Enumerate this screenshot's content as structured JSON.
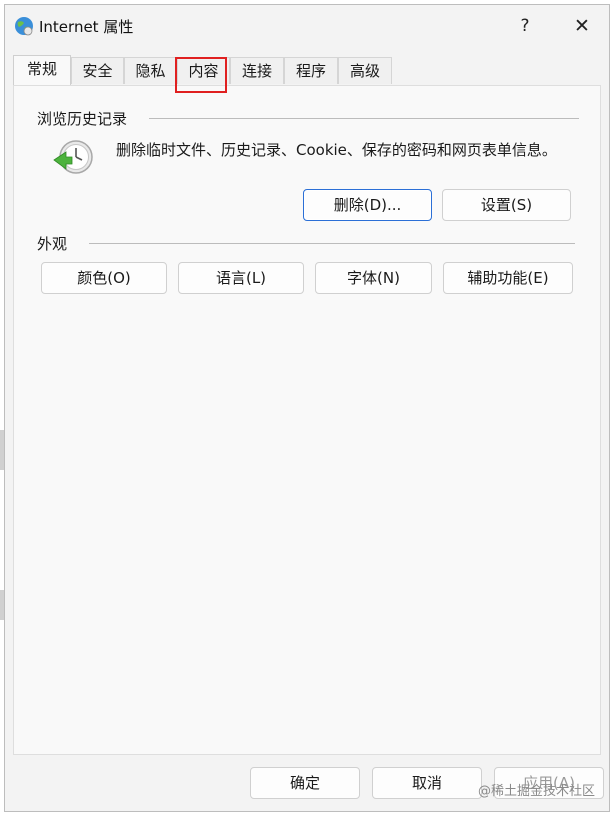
{
  "window": {
    "title": "Internet 属性",
    "help_label": "?",
    "close_label": "✕",
    "icon": "internet-options-globe-icon"
  },
  "tabs": [
    {
      "label": "常规",
      "active": true
    },
    {
      "label": "安全",
      "active": false
    },
    {
      "label": "隐私",
      "active": false
    },
    {
      "label": "内容",
      "active": false,
      "highlighted": true
    },
    {
      "label": "连接",
      "active": false
    },
    {
      "label": "程序",
      "active": false
    },
    {
      "label": "高级",
      "active": false
    }
  ],
  "browsing_history": {
    "group_label": "浏览历史记录",
    "description": "删除临时文件、历史记录、Cookie、保存的密码和网页表单信息。",
    "icon": "history-clock-icon",
    "delete_button": "删除(D)...",
    "settings_button": "设置(S)"
  },
  "appearance": {
    "group_label": "外观",
    "colors_button": "颜色(O)",
    "languages_button": "语言(L)",
    "fonts_button": "字体(N)",
    "accessibility_button": "辅助功能(E)"
  },
  "footer": {
    "ok_button": "确定",
    "cancel_button": "取消",
    "apply_button": "应用(A)"
  },
  "watermark": "@稀土掘金技术社区",
  "colors": {
    "highlight_border": "#e02020",
    "focus_border": "#2b6fd6"
  }
}
